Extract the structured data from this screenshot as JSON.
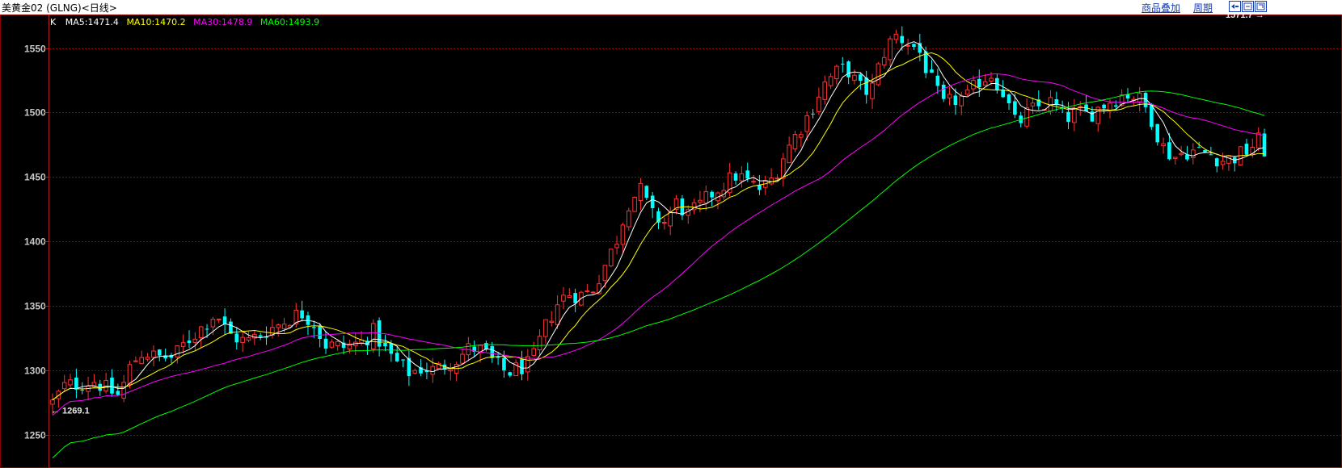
{
  "window": {
    "title": "美黄金02 (GLNG)<日线>",
    "links": [
      "商品叠加",
      "周期"
    ],
    "window_buttons": [
      "restore-icon",
      "fullscreen-icon",
      "close-icon"
    ]
  },
  "colors": {
    "up": "#ff3232",
    "down": "#00ffff",
    "ma5": "#ffffff",
    "ma10": "#ffff00",
    "ma30": "#ff00ff",
    "ma60": "#00ff00",
    "grid": "#8b0000",
    "frame": "#8b0000"
  },
  "chart_data": {
    "type": "candlestick",
    "indicator": "K",
    "ma_legend": [
      {
        "name": "MA5",
        "label": "MA5:1471.4",
        "color": "#ffffff"
      },
      {
        "name": "MA10",
        "label": "MA10:1470.2",
        "color": "#ffff00"
      },
      {
        "name": "MA30",
        "label": "MA30:1478.9",
        "color": "#ff00ff"
      },
      {
        "name": "MA60",
        "label": "MA60:1493.9",
        "color": "#00ff00"
      }
    ],
    "y_ticks": [
      1250,
      1300,
      1350,
      1400,
      1450,
      1500,
      1550
    ],
    "ylim": [
      1225,
      1576
    ],
    "grid": true,
    "annotations": [
      {
        "text": "1571.7",
        "value": 1571.7,
        "arrow": "right",
        "bar_index": 1000
      },
      {
        "text": "1269.1",
        "value": 1269.1,
        "arrow": "left",
        "bar_index": 0
      }
    ],
    "shape_points": [
      [
        0,
        1275
      ],
      [
        10,
        1288
      ],
      [
        25,
        1290
      ],
      [
        35,
        1292
      ],
      [
        45,
        1285
      ],
      [
        55,
        1280
      ],
      [
        65,
        1305
      ],
      [
        75,
        1315
      ],
      [
        85,
        1310
      ],
      [
        100,
        1310
      ],
      [
        110,
        1322
      ],
      [
        125,
        1335
      ],
      [
        135,
        1345
      ],
      [
        145,
        1328
      ],
      [
        160,
        1322
      ],
      [
        175,
        1330
      ],
      [
        185,
        1335
      ],
      [
        195,
        1340
      ],
      [
        205,
        1345
      ],
      [
        215,
        1338
      ],
      [
        225,
        1320
      ],
      [
        240,
        1318
      ],
      [
        255,
        1322
      ],
      [
        265,
        1330
      ],
      [
        275,
        1315
      ],
      [
        285,
        1305
      ],
      [
        295,
        1298
      ],
      [
        305,
        1302
      ],
      [
        315,
        1300
      ],
      [
        325,
        1305
      ],
      [
        335,
        1310
      ],
      [
        345,
        1318
      ],
      [
        355,
        1315
      ],
      [
        365,
        1305
      ],
      [
        375,
        1298
      ],
      [
        385,
        1302
      ],
      [
        395,
        1305
      ],
      [
        405,
        1330
      ],
      [
        415,
        1350
      ],
      [
        425,
        1360
      ],
      [
        435,
        1358
      ],
      [
        445,
        1362
      ],
      [
        455,
        1380
      ],
      [
        465,
        1400
      ],
      [
        475,
        1430
      ],
      [
        485,
        1440
      ],
      [
        495,
        1420
      ],
      [
        505,
        1415
      ],
      [
        515,
        1430
      ],
      [
        525,
        1420
      ],
      [
        535,
        1428
      ],
      [
        545,
        1438
      ],
      [
        555,
        1445
      ],
      [
        565,
        1452
      ],
      [
        575,
        1445
      ],
      [
        585,
        1440
      ],
      [
        595,
        1450
      ],
      [
        605,
        1470
      ],
      [
        615,
        1485
      ],
      [
        625,
        1500
      ],
      [
        635,
        1520
      ],
      [
        645,
        1530
      ],
      [
        655,
        1535
      ],
      [
        665,
        1520
      ],
      [
        675,
        1515
      ],
      [
        685,
        1545
      ],
      [
        695,
        1560
      ],
      [
        705,
        1555
      ],
      [
        715,
        1548
      ],
      [
        725,
        1525
      ],
      [
        735,
        1505
      ],
      [
        745,
        1510
      ],
      [
        755,
        1512
      ],
      [
        765,
        1525
      ],
      [
        775,
        1530
      ],
      [
        785,
        1515
      ],
      [
        795,
        1490
      ],
      [
        805,
        1500
      ],
      [
        815,
        1505
      ],
      [
        825,
        1508
      ],
      [
        835,
        1495
      ],
      [
        845,
        1500
      ],
      [
        855,
        1498
      ],
      [
        865,
        1505
      ],
      [
        875,
        1510
      ],
      [
        885,
        1515
      ],
      [
        895,
        1512
      ],
      [
        905,
        1500
      ],
      [
        915,
        1475
      ],
      [
        925,
        1465
      ],
      [
        935,
        1470
      ],
      [
        945,
        1470
      ],
      [
        955,
        1468
      ],
      [
        965,
        1463
      ],
      [
        975,
        1465
      ],
      [
        985,
        1470
      ],
      [
        995,
        1478
      ],
      [
        1000,
        1466
      ]
    ],
    "ma_end_values": {
      "ma5": 1471.4,
      "ma10": 1470.2,
      "ma30": 1478.9,
      "ma60": 1493.9
    }
  }
}
